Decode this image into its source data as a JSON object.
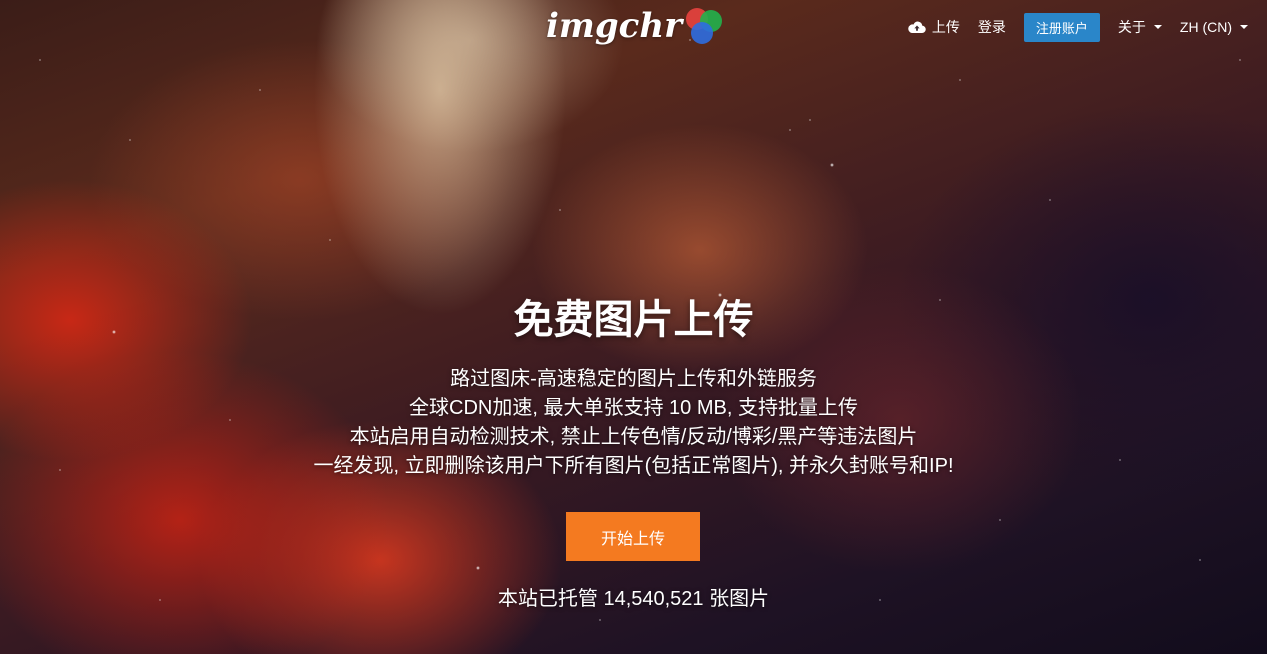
{
  "brand": {
    "logo_text": "imgchr",
    "logo_colors": [
      "#e8433f",
      "#22b14c",
      "#2e6de0"
    ]
  },
  "nav": {
    "upload": {
      "icon": "cloud-upload-icon",
      "label": "上传"
    },
    "login": "登录",
    "register": "注册账户",
    "about": "关于",
    "language": "ZH (CN)"
  },
  "hero": {
    "title": "免费图片上传",
    "lines": [
      "路过图床-高速稳定的图片上传和外链服务",
      "全球CDN加速, 最大单张支持 10 MB, 支持批量上传",
      "本站启用自动检测技术, 禁止上传色情/反动/博彩/黑产等违法图片",
      "一经发现, 立即删除该用户下所有图片(包括正常图片), 并永久封账号和IP!"
    ],
    "cta": "开始上传",
    "stats": "本站已托管 14,540,521 张图片"
  },
  "colors": {
    "accent": "#f47a20",
    "register_button": "#2a86c9"
  }
}
